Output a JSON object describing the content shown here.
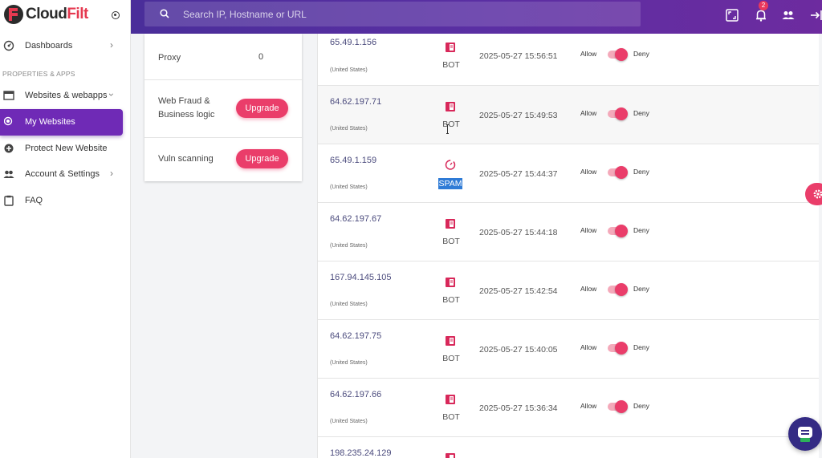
{
  "app": {
    "logo_text_main": "Cloud",
    "logo_text_accent": "Filt"
  },
  "search": {
    "placeholder": "Search IP, Hostname or URL"
  },
  "header": {
    "notification_count": "2"
  },
  "sidebar": {
    "section_label": "PROPERTIES & APPS",
    "items": [
      {
        "label": "Dashboards",
        "icon": "dashboard-icon"
      },
      {
        "label": "Websites & webapps",
        "icon": "webapps-icon"
      },
      {
        "label": "My Websites",
        "icon": "radio-icon",
        "active": true
      },
      {
        "label": "Protect New Website",
        "icon": "plus-circle-icon"
      },
      {
        "label": "Account & Settings",
        "icon": "users-icon"
      },
      {
        "label": "FAQ",
        "icon": "clipboard-icon"
      }
    ]
  },
  "features": {
    "proxy_label": "Proxy",
    "proxy_value": "0",
    "web_fraud_label_1": "Web Fraud &",
    "web_fraud_label_2": "Business logic",
    "vuln_label": "Vuln scanning",
    "upgrade_label": "Upgrade"
  },
  "requests": {
    "allow_label": "Allow",
    "deny_label": "Deny",
    "rows": [
      {
        "ip": "65.49.1.156",
        "country": "(United States)",
        "type": "BOT",
        "timestamp": "2025-05-27 15:56:51"
      },
      {
        "ip": "64.62.197.71",
        "country": "(United States)",
        "type": "BOT",
        "timestamp": "2025-05-27 15:49:53"
      },
      {
        "ip": "65.49.1.159",
        "country": "(United States)",
        "type": "SPAM",
        "timestamp": "2025-05-27 15:44:37"
      },
      {
        "ip": "64.62.197.67",
        "country": "(United States)",
        "type": "BOT",
        "timestamp": "2025-05-27 15:44:18"
      },
      {
        "ip": "167.94.145.105",
        "country": "(United States)",
        "type": "BOT",
        "timestamp": "2025-05-27 15:42:54"
      },
      {
        "ip": "64.62.197.75",
        "country": "(United States)",
        "type": "BOT",
        "timestamp": "2025-05-27 15:40:05"
      },
      {
        "ip": "64.62.197.66",
        "country": "(United States)",
        "type": "BOT",
        "timestamp": "2025-05-27 15:36:34"
      },
      {
        "ip": "198.235.24.129",
        "country": "",
        "type": "",
        "timestamp": ""
      }
    ]
  },
  "colors": {
    "accent": "#ea3d6a",
    "header": "#5a2fa3",
    "active_nav": "#6f2ab6"
  }
}
